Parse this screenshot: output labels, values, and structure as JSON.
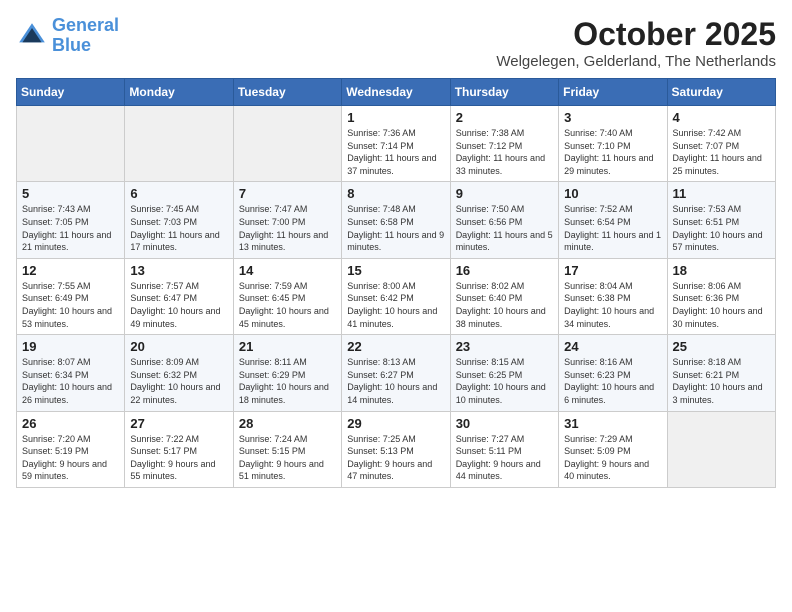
{
  "header": {
    "logo_line1": "General",
    "logo_line2": "Blue",
    "month_title": "October 2025",
    "location": "Welgelegen, Gelderland, The Netherlands"
  },
  "weekdays": [
    "Sunday",
    "Monday",
    "Tuesday",
    "Wednesday",
    "Thursday",
    "Friday",
    "Saturday"
  ],
  "weeks": [
    [
      {
        "day": "",
        "sunrise": "",
        "sunset": "",
        "daylight": ""
      },
      {
        "day": "",
        "sunrise": "",
        "sunset": "",
        "daylight": ""
      },
      {
        "day": "",
        "sunrise": "",
        "sunset": "",
        "daylight": ""
      },
      {
        "day": "1",
        "sunrise": "Sunrise: 7:36 AM",
        "sunset": "Sunset: 7:14 PM",
        "daylight": "Daylight: 11 hours and 37 minutes."
      },
      {
        "day": "2",
        "sunrise": "Sunrise: 7:38 AM",
        "sunset": "Sunset: 7:12 PM",
        "daylight": "Daylight: 11 hours and 33 minutes."
      },
      {
        "day": "3",
        "sunrise": "Sunrise: 7:40 AM",
        "sunset": "Sunset: 7:10 PM",
        "daylight": "Daylight: 11 hours and 29 minutes."
      },
      {
        "day": "4",
        "sunrise": "Sunrise: 7:42 AM",
        "sunset": "Sunset: 7:07 PM",
        "daylight": "Daylight: 11 hours and 25 minutes."
      }
    ],
    [
      {
        "day": "5",
        "sunrise": "Sunrise: 7:43 AM",
        "sunset": "Sunset: 7:05 PM",
        "daylight": "Daylight: 11 hours and 21 minutes."
      },
      {
        "day": "6",
        "sunrise": "Sunrise: 7:45 AM",
        "sunset": "Sunset: 7:03 PM",
        "daylight": "Daylight: 11 hours and 17 minutes."
      },
      {
        "day": "7",
        "sunrise": "Sunrise: 7:47 AM",
        "sunset": "Sunset: 7:00 PM",
        "daylight": "Daylight: 11 hours and 13 minutes."
      },
      {
        "day": "8",
        "sunrise": "Sunrise: 7:48 AM",
        "sunset": "Sunset: 6:58 PM",
        "daylight": "Daylight: 11 hours and 9 minutes."
      },
      {
        "day": "9",
        "sunrise": "Sunrise: 7:50 AM",
        "sunset": "Sunset: 6:56 PM",
        "daylight": "Daylight: 11 hours and 5 minutes."
      },
      {
        "day": "10",
        "sunrise": "Sunrise: 7:52 AM",
        "sunset": "Sunset: 6:54 PM",
        "daylight": "Daylight: 11 hours and 1 minute."
      },
      {
        "day": "11",
        "sunrise": "Sunrise: 7:53 AM",
        "sunset": "Sunset: 6:51 PM",
        "daylight": "Daylight: 10 hours and 57 minutes."
      }
    ],
    [
      {
        "day": "12",
        "sunrise": "Sunrise: 7:55 AM",
        "sunset": "Sunset: 6:49 PM",
        "daylight": "Daylight: 10 hours and 53 minutes."
      },
      {
        "day": "13",
        "sunrise": "Sunrise: 7:57 AM",
        "sunset": "Sunset: 6:47 PM",
        "daylight": "Daylight: 10 hours and 49 minutes."
      },
      {
        "day": "14",
        "sunrise": "Sunrise: 7:59 AM",
        "sunset": "Sunset: 6:45 PM",
        "daylight": "Daylight: 10 hours and 45 minutes."
      },
      {
        "day": "15",
        "sunrise": "Sunrise: 8:00 AM",
        "sunset": "Sunset: 6:42 PM",
        "daylight": "Daylight: 10 hours and 41 minutes."
      },
      {
        "day": "16",
        "sunrise": "Sunrise: 8:02 AM",
        "sunset": "Sunset: 6:40 PM",
        "daylight": "Daylight: 10 hours and 38 minutes."
      },
      {
        "day": "17",
        "sunrise": "Sunrise: 8:04 AM",
        "sunset": "Sunset: 6:38 PM",
        "daylight": "Daylight: 10 hours and 34 minutes."
      },
      {
        "day": "18",
        "sunrise": "Sunrise: 8:06 AM",
        "sunset": "Sunset: 6:36 PM",
        "daylight": "Daylight: 10 hours and 30 minutes."
      }
    ],
    [
      {
        "day": "19",
        "sunrise": "Sunrise: 8:07 AM",
        "sunset": "Sunset: 6:34 PM",
        "daylight": "Daylight: 10 hours and 26 minutes."
      },
      {
        "day": "20",
        "sunrise": "Sunrise: 8:09 AM",
        "sunset": "Sunset: 6:32 PM",
        "daylight": "Daylight: 10 hours and 22 minutes."
      },
      {
        "day": "21",
        "sunrise": "Sunrise: 8:11 AM",
        "sunset": "Sunset: 6:29 PM",
        "daylight": "Daylight: 10 hours and 18 minutes."
      },
      {
        "day": "22",
        "sunrise": "Sunrise: 8:13 AM",
        "sunset": "Sunset: 6:27 PM",
        "daylight": "Daylight: 10 hours and 14 minutes."
      },
      {
        "day": "23",
        "sunrise": "Sunrise: 8:15 AM",
        "sunset": "Sunset: 6:25 PM",
        "daylight": "Daylight: 10 hours and 10 minutes."
      },
      {
        "day": "24",
        "sunrise": "Sunrise: 8:16 AM",
        "sunset": "Sunset: 6:23 PM",
        "daylight": "Daylight: 10 hours and 6 minutes."
      },
      {
        "day": "25",
        "sunrise": "Sunrise: 8:18 AM",
        "sunset": "Sunset: 6:21 PM",
        "daylight": "Daylight: 10 hours and 3 minutes."
      }
    ],
    [
      {
        "day": "26",
        "sunrise": "Sunrise: 7:20 AM",
        "sunset": "Sunset: 5:19 PM",
        "daylight": "Daylight: 9 hours and 59 minutes."
      },
      {
        "day": "27",
        "sunrise": "Sunrise: 7:22 AM",
        "sunset": "Sunset: 5:17 PM",
        "daylight": "Daylight: 9 hours and 55 minutes."
      },
      {
        "day": "28",
        "sunrise": "Sunrise: 7:24 AM",
        "sunset": "Sunset: 5:15 PM",
        "daylight": "Daylight: 9 hours and 51 minutes."
      },
      {
        "day": "29",
        "sunrise": "Sunrise: 7:25 AM",
        "sunset": "Sunset: 5:13 PM",
        "daylight": "Daylight: 9 hours and 47 minutes."
      },
      {
        "day": "30",
        "sunrise": "Sunrise: 7:27 AM",
        "sunset": "Sunset: 5:11 PM",
        "daylight": "Daylight: 9 hours and 44 minutes."
      },
      {
        "day": "31",
        "sunrise": "Sunrise: 7:29 AM",
        "sunset": "Sunset: 5:09 PM",
        "daylight": "Daylight: 9 hours and 40 minutes."
      },
      {
        "day": "",
        "sunrise": "",
        "sunset": "",
        "daylight": ""
      }
    ]
  ]
}
